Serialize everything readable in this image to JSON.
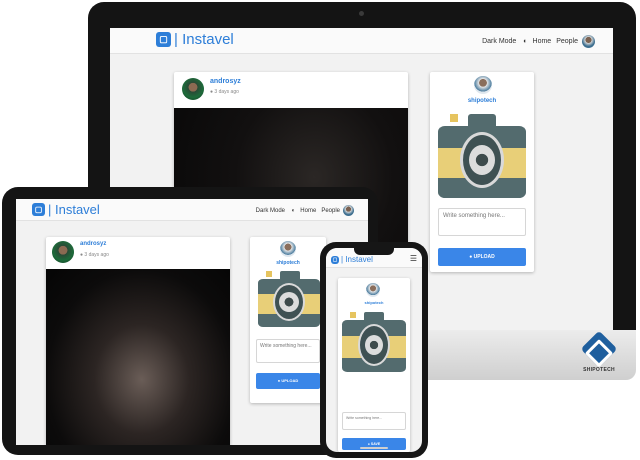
{
  "app": {
    "brand": "| Instavel",
    "nav": {
      "dark_mode": "Dark Mode",
      "home": "Home",
      "people": "People",
      "menu_icon": "☰"
    },
    "dark_mode_icon": "◐",
    "post": {
      "username": "androsyz",
      "timestamp": "3 days ago",
      "clock_icon": "🕓"
    },
    "profile": {
      "username": "shipotech"
    },
    "composer": {
      "placeholder_desktop": "Write something here...",
      "placeholder_tablet": "Write something here...",
      "placeholder_phone": "Write something here...",
      "upload_label": "UPLOAD",
      "upload_label_phone": "SAVE",
      "upload_icon": "👤"
    }
  },
  "watermark": {
    "text": "SHIPOTECH"
  },
  "colors": {
    "accent": "#2d7ed8",
    "button": "#3a86e8",
    "camera_body": "#536b6e",
    "camera_band": "#e8cf78"
  }
}
